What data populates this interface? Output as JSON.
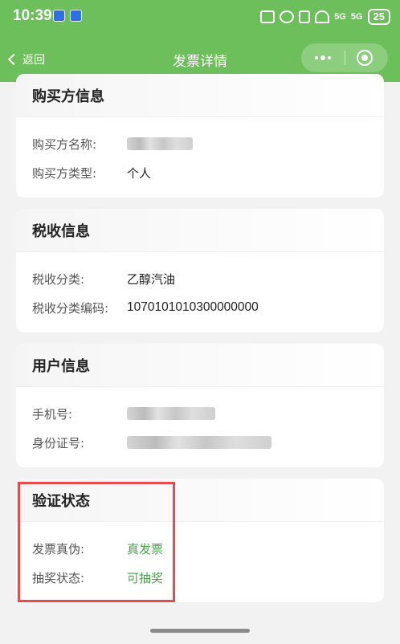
{
  "status_bar": {
    "time": "10:39",
    "signal_1": "5G",
    "signal_2": "5G",
    "battery": "25"
  },
  "nav": {
    "back_label": "返回",
    "title": "发票详情",
    "menu_icon": "more-dots-icon",
    "close_icon": "target-circle-icon"
  },
  "buyer": {
    "title": "购买方信息",
    "name_label": "购买方名称:",
    "type_label": "购买方类型:",
    "type_value": "个人"
  },
  "tax": {
    "title": "税收信息",
    "category_label": "税收分类:",
    "category_value": "乙醇汽油",
    "code_label": "税收分类编码:",
    "code_value": "1070101010300000000"
  },
  "user": {
    "title": "用户信息",
    "phone_label": "手机号:",
    "id_label": "身份证号:"
  },
  "verify": {
    "title": "验证状态",
    "authenticity_label": "发票真伪:",
    "authenticity_value": "真发票",
    "lottery_label": "抽奖状态:",
    "lottery_value": "可抽奖"
  },
  "colors": {
    "header_green": "#6cbf5a",
    "status_green": "#4aa34a",
    "highlight_red": "#e84b4b"
  }
}
